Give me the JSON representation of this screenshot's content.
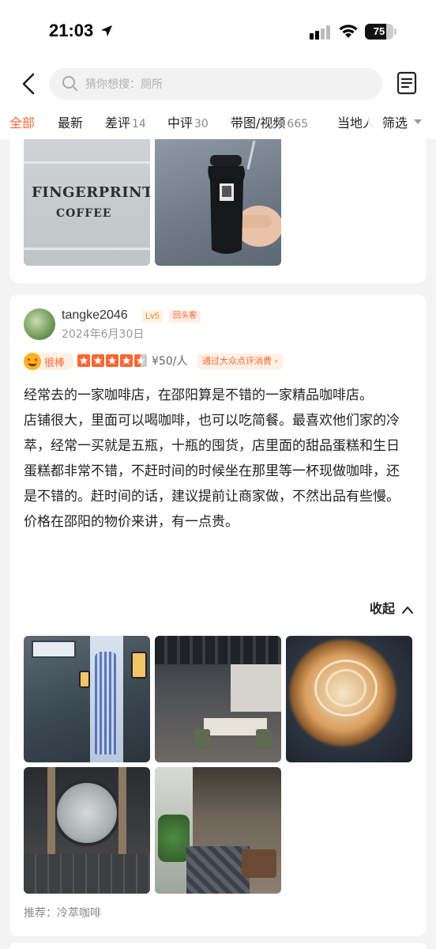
{
  "status_bar": {
    "time": "21:03",
    "battery_level": "75",
    "icons": [
      "location-arrow-icon",
      "cellular-signal-icon",
      "wifi-icon",
      "battery-icon"
    ]
  },
  "header": {
    "search_placeholder": "猜你想搜：厕所",
    "icons": [
      "back-icon",
      "search-icon",
      "document-icon"
    ]
  },
  "tabs": [
    {
      "label": "全部",
      "count": "",
      "active": true
    },
    {
      "label": "最新",
      "count": ""
    },
    {
      "label": "差评",
      "count": "14"
    },
    {
      "label": "中评",
      "count": "30"
    },
    {
      "label": "带图/视频",
      "count": "665"
    },
    {
      "label": "当地人",
      "count": ""
    }
  ],
  "filter": {
    "label": "筛选",
    "icon": "caret-down-icon"
  },
  "review": {
    "username": "tangke2046",
    "level": "Lv5",
    "badge": "回头客",
    "date": "2024年6月30日",
    "praise": "很棒",
    "stars": 4.5,
    "price": "¥50/人",
    "source": "通过大众点评消费",
    "text": "经常去的一家咖啡店，在邵阳算是不错的一家精品咖啡店。\n店铺很大，里面可以喝咖啡，也可以吃简餐。最喜欢他们家的冷萃，经常一买就是五瓶，十瓶的囤货，店里面的甜品蛋糕和生日蛋糕都非常不错，不赶时间的时候坐在那里等一杯现做咖啡，还是不错的。赶时间的话，建议提前让商家做，不然出品有些慢。\n价格在邵阳的物价来讲，有一点贵。",
    "collapse": "收起",
    "recommend_label": "推荐：",
    "recommend_item": "冷萃咖啡"
  },
  "prev_photos": {
    "sign_line1": "FINGERPRINT",
    "sign_line2": "COFFEE"
  },
  "colors": {
    "accent": "#ff6633",
    "background": "#f3f3f3",
    "card": "#ffffff",
    "muted": "#999999"
  }
}
